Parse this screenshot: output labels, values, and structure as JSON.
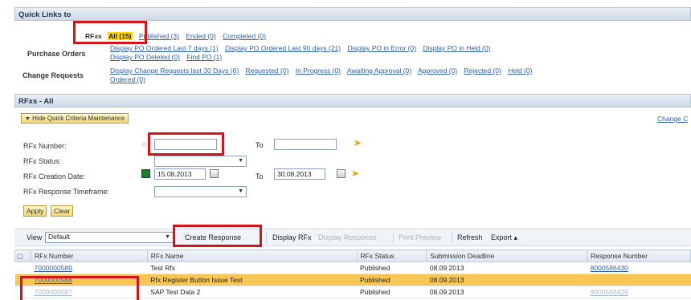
{
  "quick_links": {
    "title": "Quick Links to",
    "rfxs": {
      "label": "RFxs",
      "links": [
        "All (15)",
        "Published (3)",
        "Ended (0)",
        "Completed (0)"
      ]
    },
    "purchase_orders": {
      "label": "Purchase Orders",
      "line1": [
        "Display PO Ordered Last 7 days (1)",
        "Display PO Ordered Last 90 days (21)",
        "Display PO in Error (0)",
        "Display PO in Held (0)"
      ],
      "line2": [
        "Display PO Deleted (0)",
        "Find PO (1)"
      ]
    },
    "change_requests": {
      "label": "Change Requests",
      "line1": [
        "Display Change Requests last 30 Days (6)",
        "Requested (0)",
        "In Progress (0)",
        "Awaiting Approval (0)",
        "Approved (0)",
        "Rejected (0)",
        "Held (0)"
      ],
      "line2": [
        "Ordered (0)"
      ]
    }
  },
  "rfxs_panel": {
    "title": "RFxs - All",
    "hide_criteria_button": "Hide Quick Criteria Maintenance",
    "change_link": "Change C",
    "fields": {
      "rfx_number": {
        "label": "RFx Number:",
        "value": "",
        "to_label": "To",
        "to_value": ""
      },
      "rfx_status": {
        "label": "RFx Status:",
        "value": ""
      },
      "creation_date": {
        "label": "RFx Creation Date:",
        "from": "15.08.2013",
        "to_label": "To",
        "to": "30.08.2013"
      },
      "response_timeframe": {
        "label": "RFx Response Timeframe:",
        "value": ""
      }
    },
    "apply_button": "Apply",
    "clear_button": "Clear"
  },
  "toolbar": {
    "view_label": "View",
    "view_value": "Default",
    "create_response": "Create Response",
    "display_rfx": "Display RFx",
    "display_response": "Display Response",
    "print_preview": "Print Preview",
    "refresh": "Refresh",
    "export": "Export ▴"
  },
  "table": {
    "columns": [
      "RFx Number",
      "RFx Name",
      "RFx Status",
      "Submission Deadline",
      "Response Number"
    ],
    "rows": [
      {
        "number": "7000000589",
        "name": "Test Rfx",
        "status": "Published",
        "deadline": "08.09.2013",
        "response": "8000586430"
      },
      {
        "number": "7000000588",
        "name": "Rfx Register Button Issue Test",
        "status": "Published",
        "deadline": "08.09.2013",
        "response": ""
      },
      {
        "number": "7000000587",
        "name": "SAP Test Data 2",
        "status": "Published",
        "deadline": "08.09.2013",
        "response": "8000586429"
      }
    ]
  },
  "colors": {
    "highlight_red": "#d2151b",
    "selected_row": "#f7c654",
    "link": "#2f5ea8"
  }
}
